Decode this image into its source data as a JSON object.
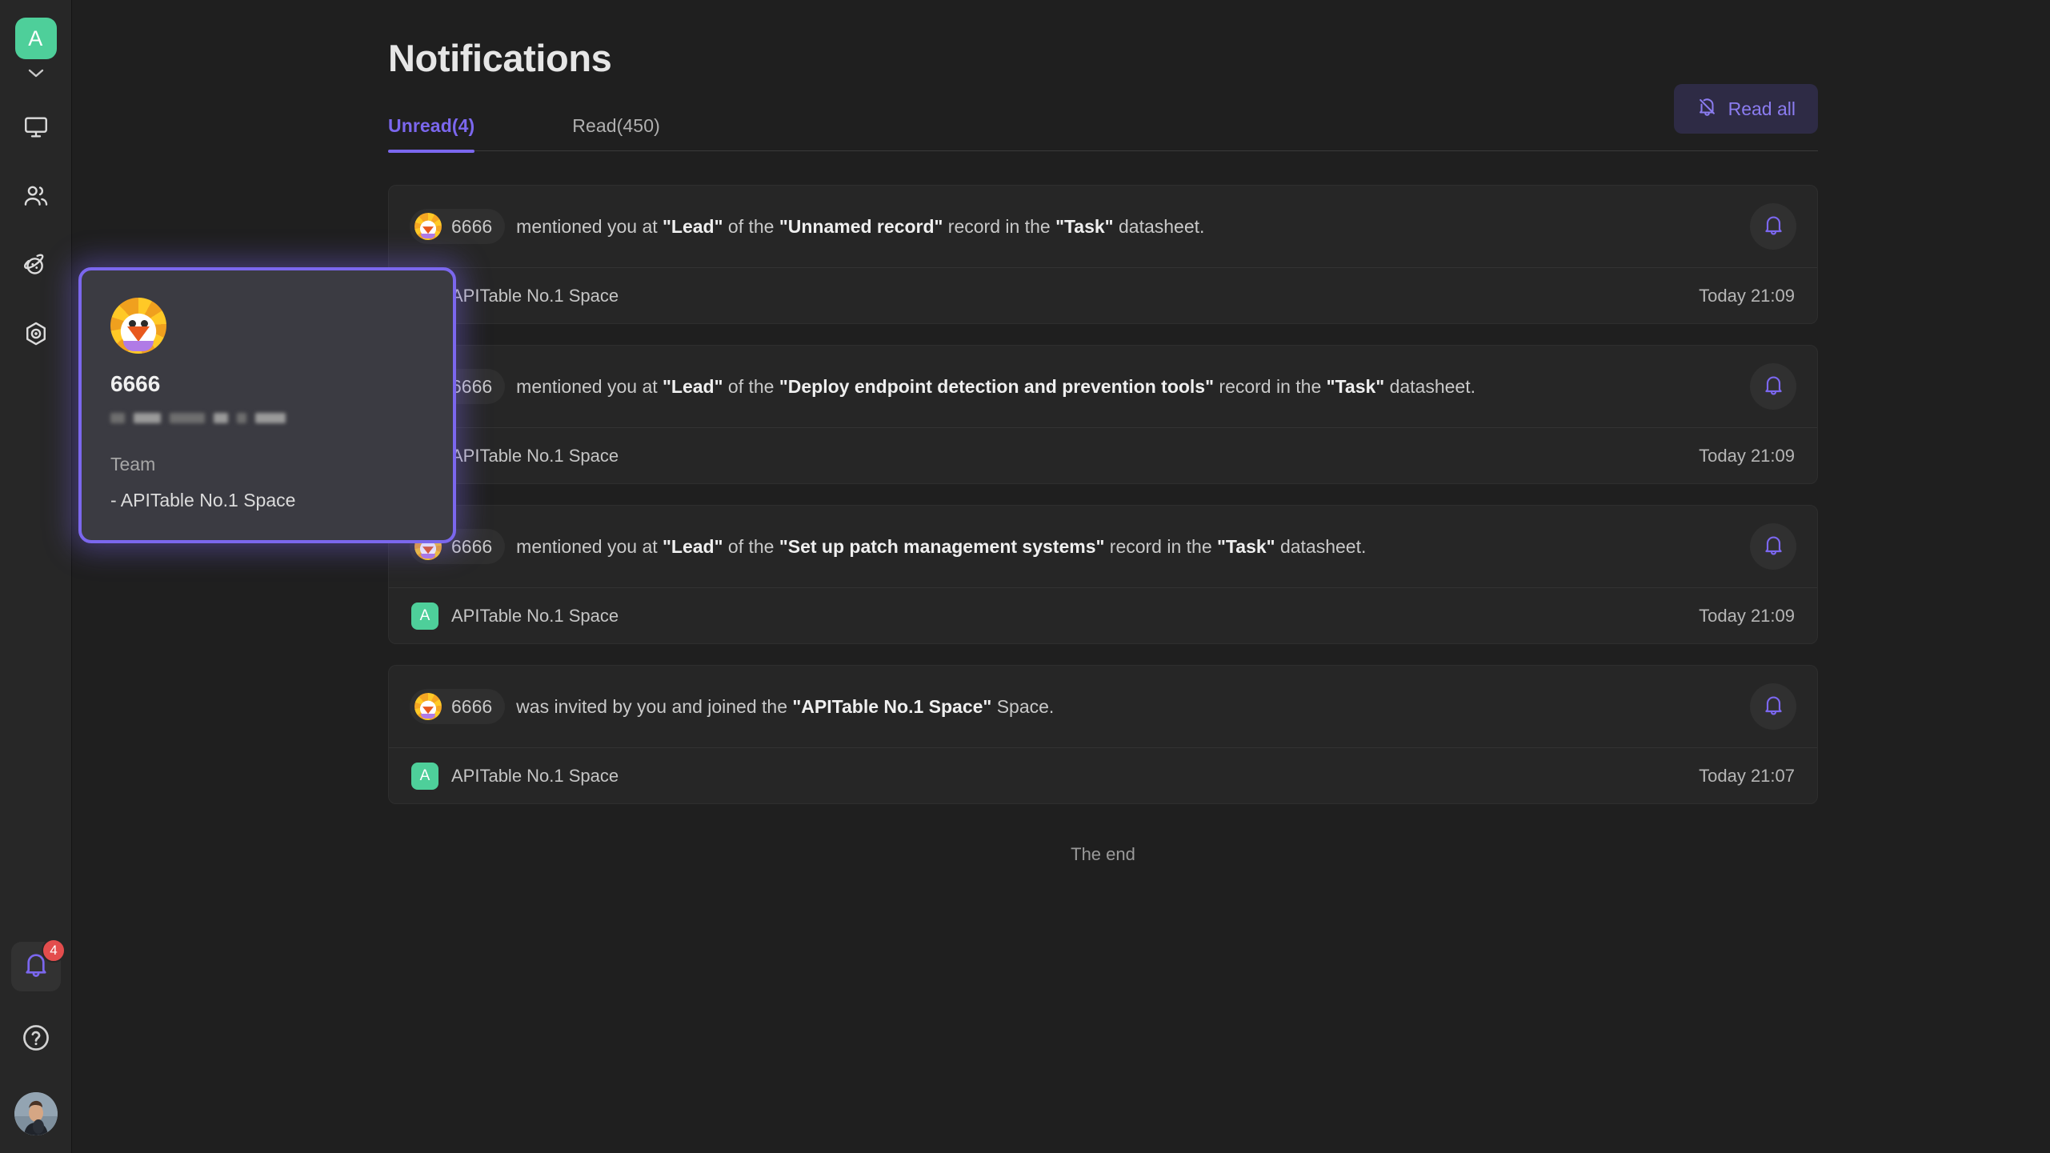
{
  "sidebar": {
    "workspace_avatar_letter": "A",
    "items": [
      {
        "name": "workspace-switcher",
        "icon": "chevron-down-icon"
      },
      {
        "name": "workbench",
        "icon": "monitor-icon"
      },
      {
        "name": "members",
        "icon": "people-icon"
      },
      {
        "name": "space-explore",
        "icon": "planet-icon"
      },
      {
        "name": "templates",
        "icon": "hexagon-target-icon"
      }
    ],
    "bottom": {
      "notification_badge": "4",
      "help_icon": "question-circle-icon",
      "user_avatar": "avatar-photo"
    }
  },
  "header": {
    "title": "Notifications"
  },
  "tabs": [
    {
      "label": "Unread(4)",
      "active": true
    },
    {
      "label": "Read(450)",
      "active": false
    }
  ],
  "toolbar": {
    "read_all_label": "Read all",
    "read_all_icon": "bell-slash-icon"
  },
  "accent": {
    "purple": "#7b67ee",
    "green": "#4ecf9a",
    "badge_red": "#e34d4d"
  },
  "notifications": [
    {
      "user": "6666",
      "avatar": "chicken-avatar",
      "segments": [
        {
          "t": "mentioned you at ",
          "b": false
        },
        {
          "t": "\"Lead\"",
          "b": true
        },
        {
          "t": " of the ",
          "b": false
        },
        {
          "t": "\"Unnamed record\"",
          "b": true
        },
        {
          "t": " record in the ",
          "b": false
        },
        {
          "t": "\"Task\"",
          "b": true
        },
        {
          "t": " datasheet.",
          "b": false
        }
      ],
      "space_avatar_letter": "A",
      "space": "APITable No.1 Space",
      "time": "Today 21:09",
      "action_icon": "bell-icon"
    },
    {
      "user": "6666",
      "avatar": "chicken-avatar",
      "segments": [
        {
          "t": "mentioned you at ",
          "b": false
        },
        {
          "t": "\"Lead\"",
          "b": true
        },
        {
          "t": " of the ",
          "b": false
        },
        {
          "t": "\"Deploy endpoint detection and prevention tools\"",
          "b": true
        },
        {
          "t": " record in the ",
          "b": false
        },
        {
          "t": "\"Task\"",
          "b": true
        },
        {
          "t": " datasheet.",
          "b": false
        }
      ],
      "space_avatar_letter": "A",
      "space": "APITable No.1 Space",
      "time": "Today 21:09",
      "action_icon": "bell-icon"
    },
    {
      "user": "6666",
      "avatar": "chicken-avatar",
      "segments": [
        {
          "t": "mentioned you at ",
          "b": false
        },
        {
          "t": "\"Lead\"",
          "b": true
        },
        {
          "t": " of the ",
          "b": false
        },
        {
          "t": "\"Set up patch management systems\"",
          "b": true
        },
        {
          "t": " record in the ",
          "b": false
        },
        {
          "t": "\"Task\"",
          "b": true
        },
        {
          "t": " datasheet.",
          "b": false
        }
      ],
      "space_avatar_letter": "A",
      "space": "APITable No.1 Space",
      "time": "Today 21:09",
      "action_icon": "bell-icon"
    },
    {
      "user": "6666",
      "avatar": "chicken-avatar",
      "segments": [
        {
          "t": "was invited by you and joined the ",
          "b": false
        },
        {
          "t": "\"APITable No.1 Space\"",
          "b": true
        },
        {
          "t": " Space.",
          "b": false
        }
      ],
      "space_avatar_letter": "A",
      "space": "APITable No.1 Space",
      "time": "Today 21:07",
      "action_icon": "bell-icon"
    }
  ],
  "list_end_text": "The end",
  "hover_card": {
    "avatar": "chicken-avatar",
    "name": "6666",
    "redacted_widths": [
      18,
      34,
      44,
      18,
      12,
      38
    ],
    "team_label": "Team",
    "team_items": [
      "- APITable No.1 Space"
    ]
  }
}
